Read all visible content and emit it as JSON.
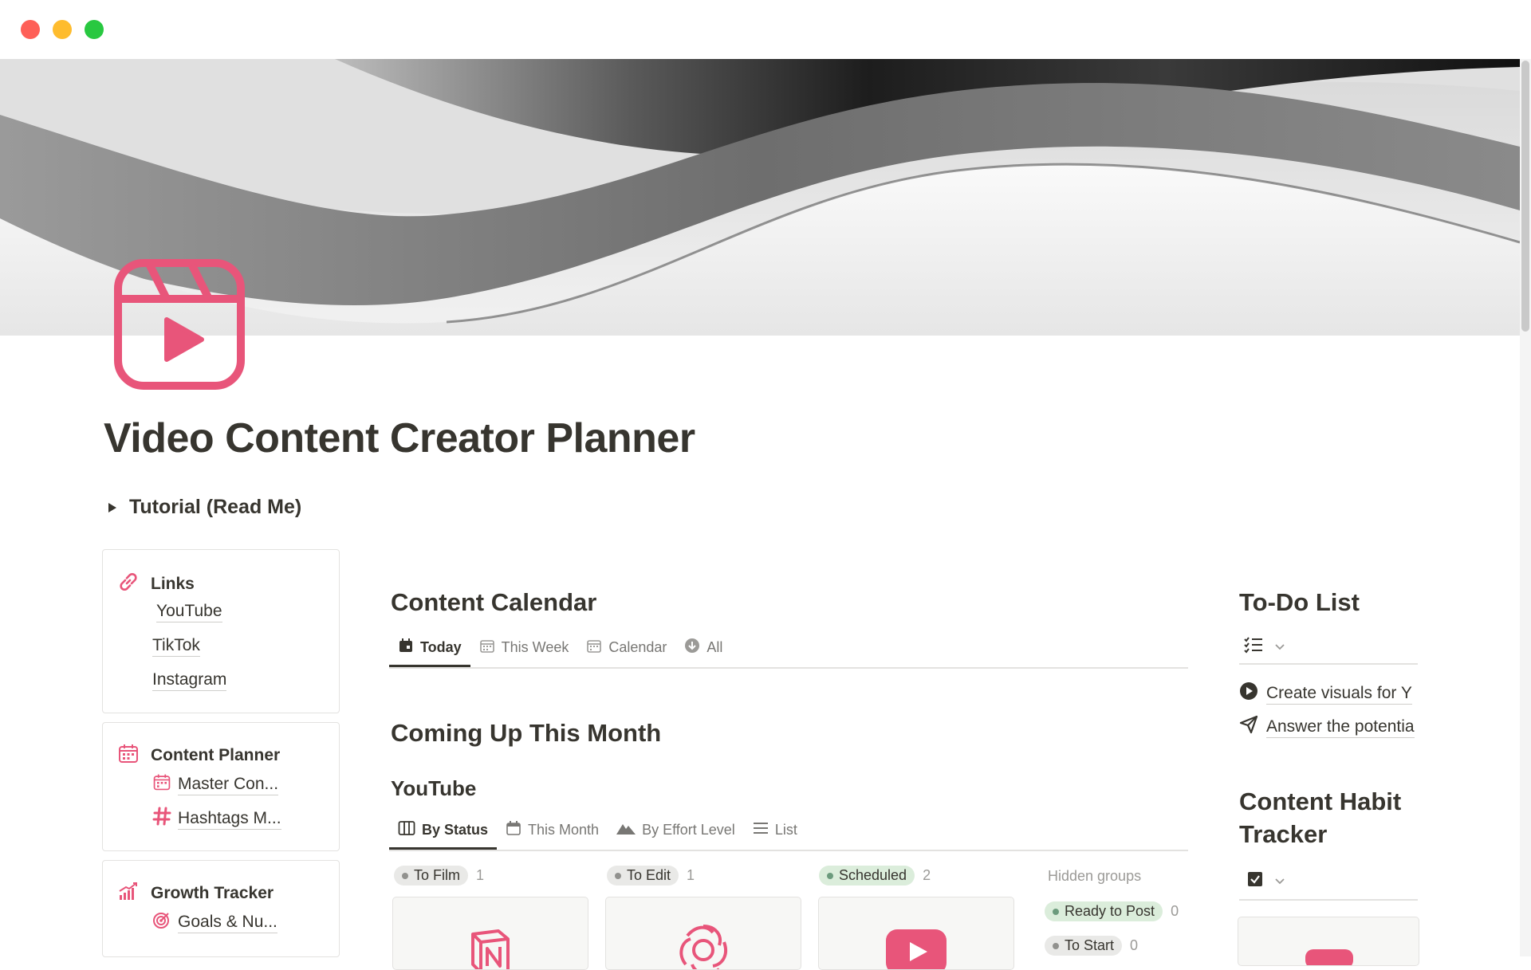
{
  "page": {
    "title": "Video Content Creator Planner",
    "toggle_label": "Tutorial (Read Me)"
  },
  "sidebar": {
    "links": {
      "heading": "Links",
      "items": [
        "YouTube",
        "TikTok",
        "Instagram"
      ]
    },
    "content_planner": {
      "heading": "Content Planner",
      "items": [
        "Master Con...",
        "Hashtags M..."
      ]
    },
    "growth_tracker": {
      "heading": "Growth Tracker",
      "items": [
        "Goals & Nu..."
      ]
    }
  },
  "content_calendar": {
    "heading": "Content Calendar",
    "tabs": [
      "Today",
      "This Week",
      "Calendar",
      "All"
    ]
  },
  "coming_up": {
    "heading": "Coming Up This Month",
    "subheading": "YouTube",
    "tabs": [
      "By Status",
      "This Month",
      "By Effort Level",
      "List"
    ],
    "groups": [
      {
        "label": "To Film",
        "count": "1"
      },
      {
        "label": "To Edit",
        "count": "1"
      },
      {
        "label": "Scheduled",
        "count": "2"
      }
    ],
    "hidden_groups": {
      "label": "Hidden groups",
      "items": [
        {
          "label": "Ready to Post",
          "count": "0"
        },
        {
          "label": "To Start",
          "count": "0"
        }
      ]
    }
  },
  "todo": {
    "heading": "To-Do List",
    "items": [
      "Create visuals for Y",
      "Answer the potentia"
    ]
  },
  "habit": {
    "heading_line1": "Content Habit",
    "heading_line2": "Tracker"
  },
  "colors": {
    "accent_pink": "#e8557a",
    "text": "#37352f",
    "muted": "#787774"
  }
}
